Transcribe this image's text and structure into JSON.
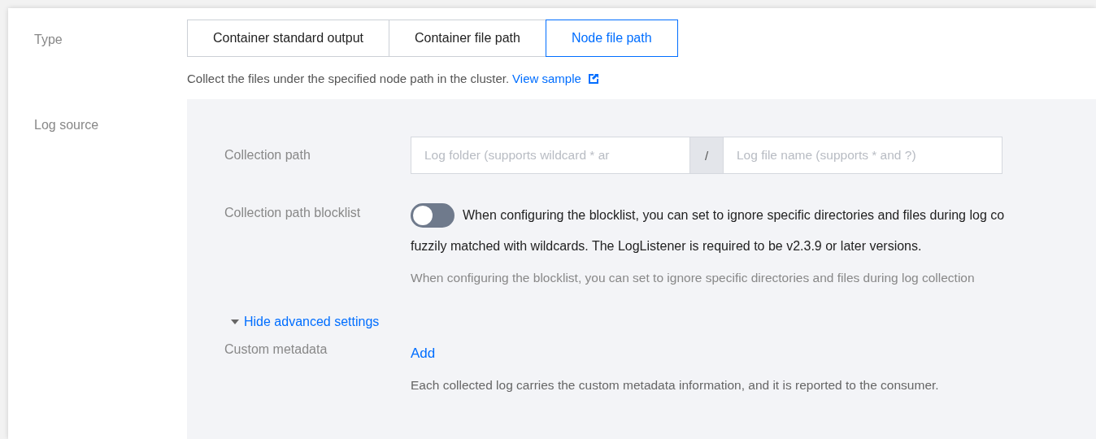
{
  "type_field": {
    "label": "Type",
    "options": [
      {
        "label": "Container standard output",
        "selected": false
      },
      {
        "label": "Container file path",
        "selected": false
      },
      {
        "label": "Node file path",
        "selected": true
      }
    ],
    "hint": "Collect the files under the specified node path in the cluster.",
    "hint_link": "View sample"
  },
  "log_source": {
    "label": "Log source",
    "collection_path": {
      "label": "Collection path",
      "folder_placeholder": "Log folder (supports wildcard * ar",
      "separator": "/",
      "file_placeholder": "Log file name (supports * and ?)"
    },
    "blocklist": {
      "label": "Collection path blocklist",
      "on": false,
      "description_lines": [
        "When configuring the blocklist, you can set to ignore specific directories and files during log co",
        "fuzzily matched with wildcards. The LogListener is required to be v2.3.9 or later versions."
      ],
      "hint": "When configuring the blocklist, you can set to ignore specific directories and files during log collection"
    },
    "advanced_toggle": {
      "label": "Hide advanced settings",
      "expanded": true
    },
    "custom_metadata": {
      "label": "Custom metadata",
      "action": "Add",
      "hint": "Each collected log carries the custom metadata information, and it is reported to the consumer."
    }
  }
}
